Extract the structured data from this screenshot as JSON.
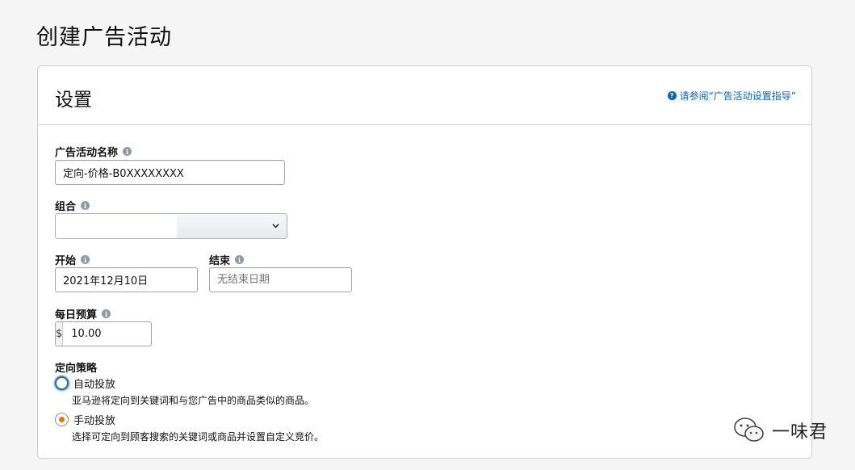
{
  "page": {
    "title": "创建广告活动"
  },
  "settings": {
    "title": "设置",
    "help_link": "请参阅“广告活动设置指导”"
  },
  "campaign_name": {
    "label": "广告活动名称",
    "value": "定向-价格-B0XXXXXXXX"
  },
  "portfolio": {
    "label": "组合",
    "value": ""
  },
  "start": {
    "label": "开始",
    "value": "2021年12月10日"
  },
  "end": {
    "label": "结束",
    "placeholder": "无结束日期"
  },
  "daily_budget": {
    "label": "每日预算",
    "currency": "$",
    "value": "10.00"
  },
  "targeting": {
    "label": "定向策略",
    "auto": {
      "label": "自动投放",
      "desc": "亚马逊将定向到关键词和与您广告中的商品类似的商品。",
      "checked": false
    },
    "manual": {
      "label": "手动投放",
      "desc": "选择可定向到顾客搜索的关键词或商品并设置自定义竞价。",
      "checked": true
    }
  },
  "watermark": {
    "text": "一味君",
    "icon": "wechat-icon"
  },
  "colors": {
    "link": "#0066c0",
    "radio_checked": "#e77600",
    "focus": "#2b6aa8"
  }
}
